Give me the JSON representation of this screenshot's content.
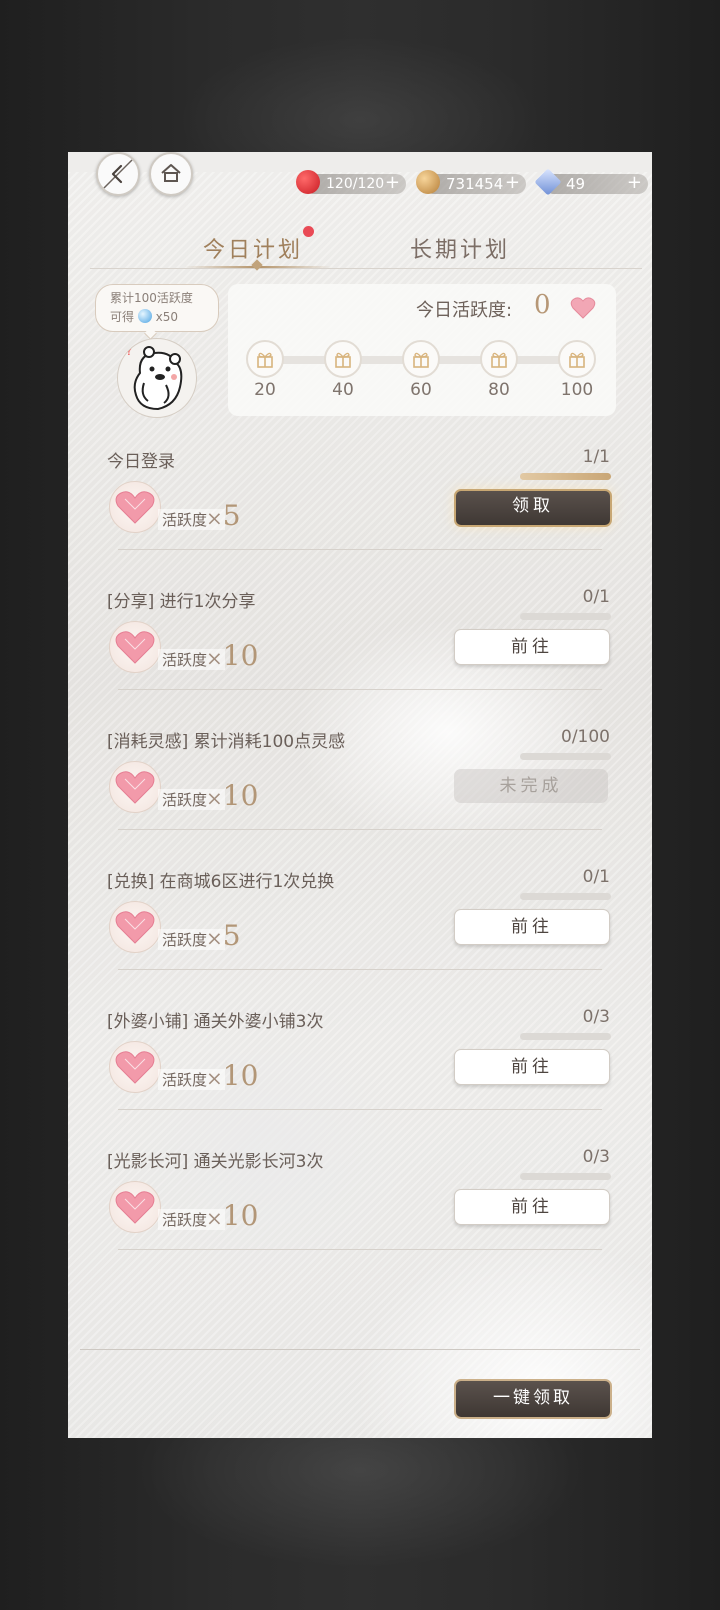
{
  "resources": {
    "stamina": {
      "value": "120/120",
      "plus": "+",
      "color": "#d4272e"
    },
    "gold": {
      "value": "731454",
      "plus": "+",
      "color": "#d9a75b"
    },
    "diamond": {
      "value": "49",
      "plus": "+",
      "color": "#6f8fd6"
    }
  },
  "tabs": [
    {
      "label": "今日计划",
      "active": true,
      "has_notification": true
    },
    {
      "label": "长期计划",
      "active": false
    }
  ],
  "bubble": {
    "line1": "累计100活跃度",
    "line2_prefix": "可得",
    "line2_suffix": "x50"
  },
  "activity": {
    "label": "今日活跃度:",
    "value": "0",
    "milestones": [
      "20",
      "40",
      "60",
      "80",
      "100"
    ]
  },
  "reward_label": "活跃度",
  "reward_mul": "×",
  "tasks": [
    {
      "title": "今日登录",
      "progress": "1/1",
      "fill": 1.0,
      "reward": "5",
      "button": "领取",
      "state": "claim"
    },
    {
      "title": "[分享] 进行1次分享",
      "progress": "0/1",
      "fill": 0,
      "reward": "10",
      "button": "前往",
      "state": "go"
    },
    {
      "title": "[消耗灵感] 累计消耗100点灵感",
      "progress": "0/100",
      "fill": 0,
      "reward": "10",
      "button": "未完成",
      "state": "incomplete"
    },
    {
      "title": "[兑换] 在商城6区进行1次兑换",
      "progress": "0/1",
      "fill": 0,
      "reward": "5",
      "button": "前往",
      "state": "go"
    },
    {
      "title": "[外婆小铺] 通关外婆小铺3次",
      "progress": "0/3",
      "fill": 0,
      "reward": "10",
      "button": "前往",
      "state": "go"
    },
    {
      "title": "[光影长河] 通关光影长河3次",
      "progress": "0/3",
      "fill": 0,
      "reward": "10",
      "button": "前往",
      "state": "go"
    }
  ],
  "claim_all_label": "一键领取"
}
